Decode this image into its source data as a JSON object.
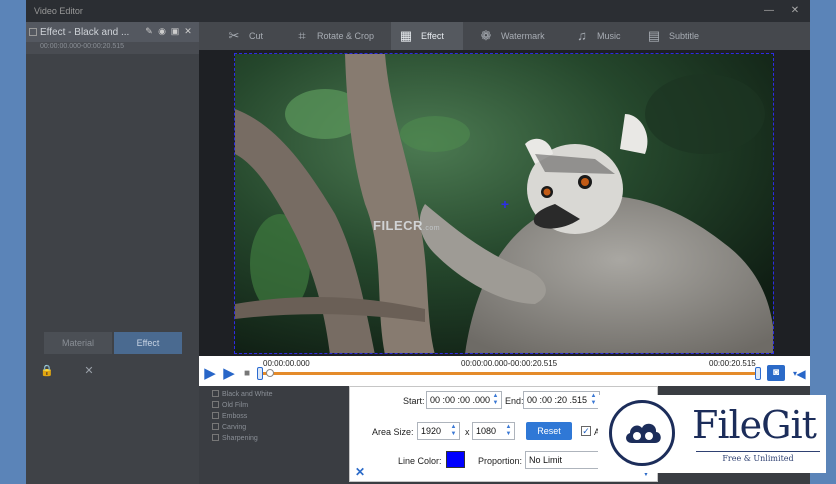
{
  "window": {
    "title": "Video Editor",
    "minimize": "—",
    "close": "✕"
  },
  "left_panel": {
    "layer_label": "Effect - Black and ...",
    "sublayer_label": "00:00:00.000-00:00:20.515",
    "tabs": [
      "Material",
      "Effect"
    ],
    "effects": [
      "Black and White",
      "Old Film",
      "Emboss",
      "Carving",
      "Sharpening"
    ]
  },
  "topnav": [
    {
      "label": "Cut",
      "icon": "scissors-icon",
      "glyph": "✂"
    },
    {
      "label": "Rotate & Crop",
      "icon": "crop-icon",
      "glyph": "⌗"
    },
    {
      "label": "Effect",
      "icon": "effect-icon",
      "glyph": "▦"
    },
    {
      "label": "Watermark",
      "icon": "watermark-icon",
      "glyph": "❁"
    },
    {
      "label": "Music",
      "icon": "music-icon",
      "glyph": "♫"
    },
    {
      "label": "Subtitle",
      "icon": "subtitle-icon",
      "glyph": "▤"
    }
  ],
  "active_tab": "Effect",
  "watermark": {
    "brand": "FILECR",
    "sub": ".com"
  },
  "timeline": {
    "start": "00:00:00.000",
    "range": "00:00:00.000-00:00:20.515",
    "end": "00:00:20.515"
  },
  "panel": {
    "start_label": "Start:",
    "start_value": "00 :00 :00 .000",
    "end_label": "End:",
    "end_value": "00 :00 :20 .515",
    "area_label": "Area Size:",
    "width": "1920",
    "x_sep": "x",
    "height": "1080",
    "reset": "Reset",
    "auto_label": "Au",
    "line_color_label": "Line Color:",
    "line_color": "#0000ff",
    "proportion_label": "Proportion:",
    "proportion_value": "No Limit"
  },
  "badge": {
    "brand": "FileGit",
    "tagline": "Free & Unlimited"
  }
}
